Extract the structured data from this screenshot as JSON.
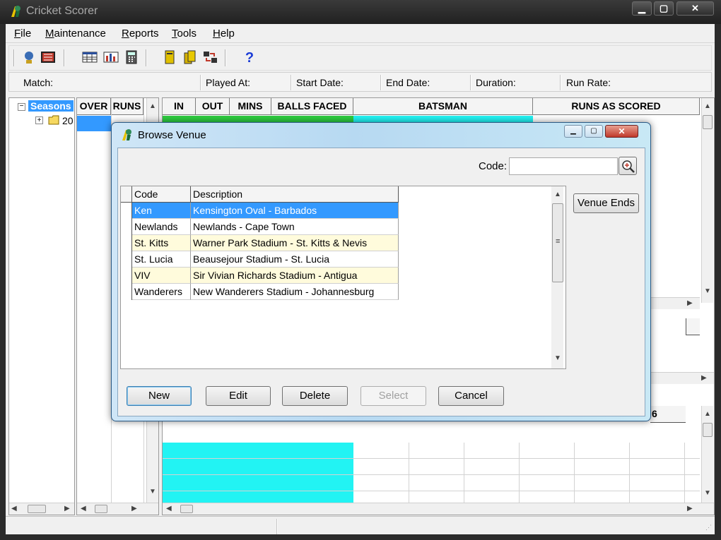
{
  "window": {
    "title": "Cricket Scorer",
    "controls": [
      "minimize",
      "maximize",
      "close"
    ]
  },
  "menu": [
    {
      "label": "File",
      "accel": "F",
      "rest": "ile"
    },
    {
      "label": "Maintenance",
      "accel": "M",
      "rest": "aintenance"
    },
    {
      "label": "Reports",
      "accel": "R",
      "rest": "eports"
    },
    {
      "label": "Tools",
      "accel": "T",
      "rest": "ools"
    },
    {
      "label": "Help",
      "accel": "H",
      "rest": "elp"
    }
  ],
  "toolbar_icons": [
    "globe-person-icon",
    "scoreboard-icon",
    "grid-icon",
    "chart-icon",
    "calculator-icon",
    "book-icon",
    "books-icon",
    "transfer-icon",
    "help-icon"
  ],
  "infobar": {
    "match": "Match:",
    "played_at": "Played At:",
    "start_date": "Start Date:",
    "end_date": "End Date:",
    "duration": "Duration:",
    "run_rate": "Run Rate:"
  },
  "tree": {
    "root": "Seasons",
    "child": "20"
  },
  "over_grid": {
    "headers": [
      "OVER",
      "RUNS"
    ]
  },
  "batting_grid": {
    "headers": [
      "IN",
      "OUT",
      "MINS",
      "BALLS FACED",
      "BATSMAN",
      "RUNS AS SCORED"
    ]
  },
  "partial_header": "6",
  "dialog": {
    "title": "Browse Venue",
    "code_label": "Code:",
    "code_value": "",
    "columns": [
      "Code",
      "Description"
    ],
    "rows": [
      {
        "code": "Ken",
        "description": "Kensington Oval - Barbados",
        "selected": true
      },
      {
        "code": "Newlands",
        "description": "Newlands - Cape Town",
        "selected": false
      },
      {
        "code": "St. Kitts",
        "description": "Warner Park Stadium - St. Kitts & Nevis",
        "selected": false
      },
      {
        "code": "St. Lucia",
        "description": "Beausejour Stadium - St. Lucia",
        "selected": false
      },
      {
        "code": "VIV",
        "description": "Sir Vivian Richards Stadium - Antigua",
        "selected": false
      },
      {
        "code": "Wanderers",
        "description": "New Wanderers Stadium - Johannesburg",
        "selected": false
      }
    ],
    "venue_ends_button": "Venue Ends",
    "buttons": {
      "new": "New",
      "edit": "Edit",
      "delete": "Delete",
      "select": "Select",
      "cancel": "Cancel"
    }
  },
  "colors": {
    "selection": "#3399ff",
    "alt_row": "#fffbdc",
    "cyan_fill": "#22f3f3",
    "green_fill": "#2ecc40"
  }
}
